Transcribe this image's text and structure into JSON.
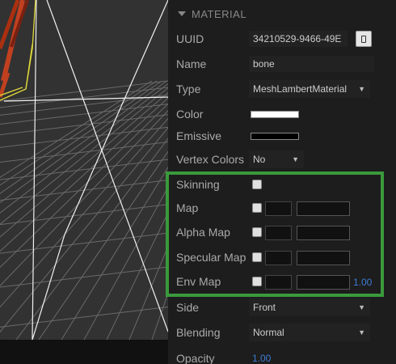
{
  "panel": {
    "header": "MATERIAL",
    "uuid": {
      "label": "UUID",
      "value": "34210529-9466-49E"
    },
    "name": {
      "label": "Name",
      "value": "bone"
    },
    "type": {
      "label": "Type",
      "value": "MeshLambertMaterial"
    },
    "color": {
      "label": "Color",
      "swatch": "#ffffff"
    },
    "emissive": {
      "label": "Emissive",
      "swatch": "#000000"
    },
    "vertex_colors": {
      "label": "Vertex Colors",
      "value": "No"
    },
    "skinning": {
      "label": "Skinning"
    },
    "map": {
      "label": "Map"
    },
    "alpha_map": {
      "label": "Alpha Map"
    },
    "specular_map": {
      "label": "Specular Map"
    },
    "env_map": {
      "label": "Env Map",
      "value": "1.00"
    },
    "side": {
      "label": "Side",
      "value": "Front"
    },
    "blending": {
      "label": "Blending",
      "value": "Normal"
    },
    "opacity": {
      "label": "Opacity",
      "value": "1.00"
    }
  },
  "colors": {
    "highlight": "#3a9a3c",
    "accent_number": "#3d7bd5",
    "viewport_bg": "#323232",
    "panel_bg": "#1d1d1d"
  }
}
